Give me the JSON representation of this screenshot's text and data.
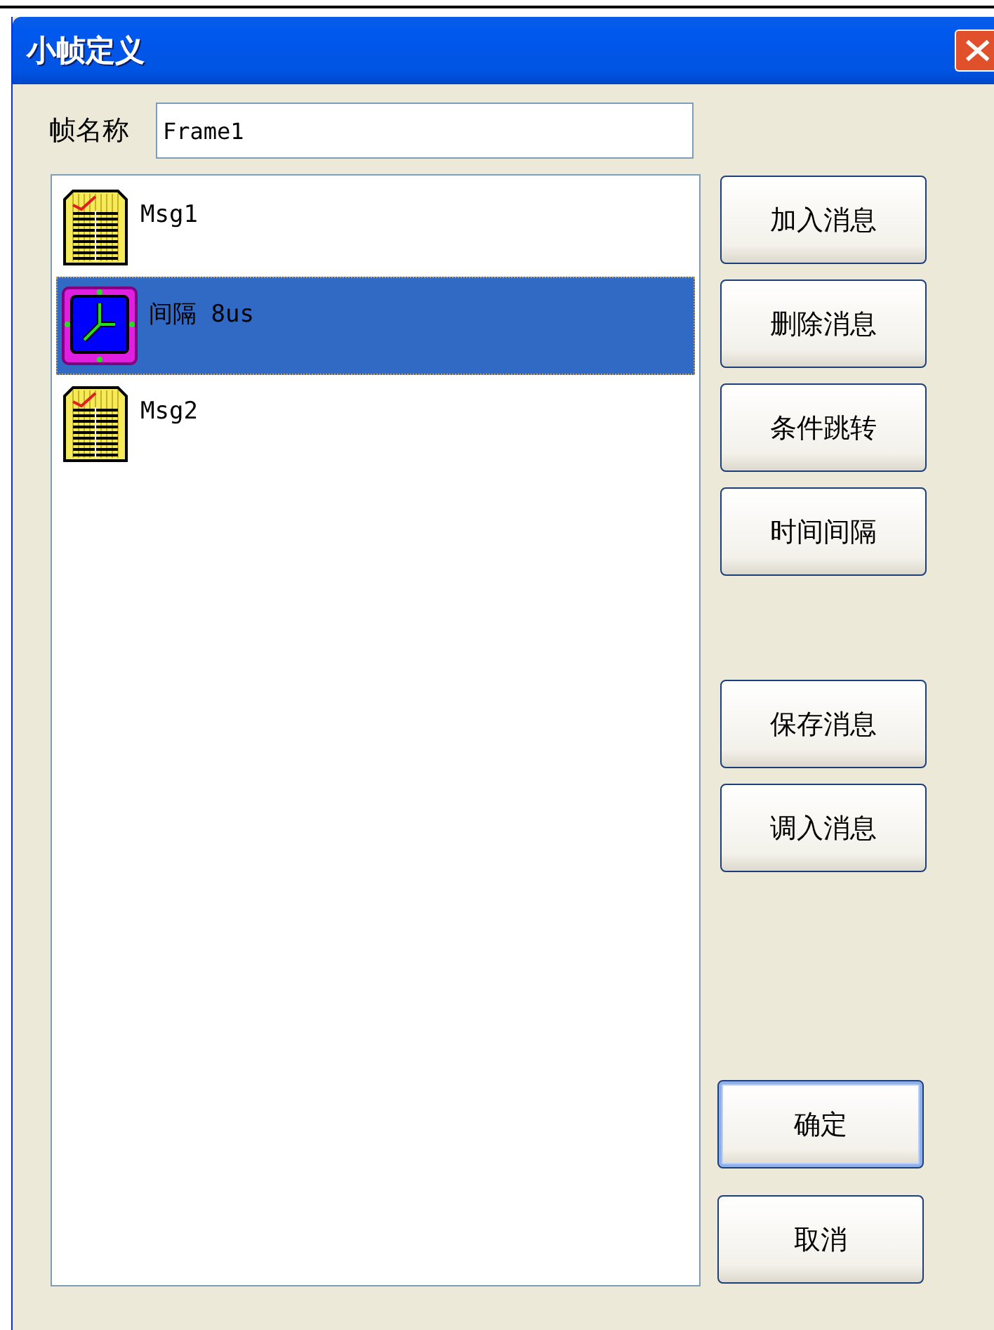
{
  "window": {
    "title": "小帧定义"
  },
  "frame_name": {
    "label": "帧名称",
    "value": "Frame1"
  },
  "items": [
    {
      "kind": "message",
      "label": "Msg1",
      "selected": false
    },
    {
      "kind": "interval",
      "label": "间隔 8us",
      "selected": true
    },
    {
      "kind": "message",
      "label": "Msg2",
      "selected": false
    }
  ],
  "action_buttons": [
    "加入消息",
    "删除消息",
    "条件跳转",
    "时间间隔"
  ],
  "file_buttons": [
    "保存消息",
    "调入消息"
  ],
  "dialog_buttons": [
    {
      "label": "确定",
      "default": true
    },
    {
      "label": "取消",
      "default": false
    }
  ]
}
